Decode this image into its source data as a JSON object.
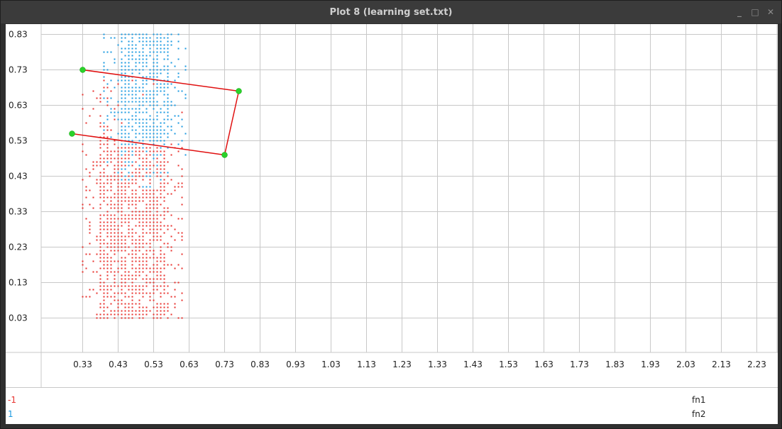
{
  "window": {
    "title": "Plot 8 (learning set.txt)",
    "buttons": {
      "minimize": "_",
      "maximize": "□",
      "close": "✕"
    }
  },
  "colors": {
    "class_neg": "#e8322e",
    "class_pos": "#1b9ae0",
    "polyline": "#e01010",
    "vertex": "#2bd12b",
    "grid": "#c8c8c8"
  },
  "legend": [
    {
      "label": "-1",
      "color": "#e8322e"
    },
    {
      "label": "1",
      "color": "#1b9ae0"
    }
  ],
  "footer": {
    "x_feature": "fn1",
    "y_feature": "fn2"
  },
  "chart_data": {
    "type": "scatter",
    "xlabel": "",
    "ylabel": "",
    "xlim": [
      0.23,
      2.28
    ],
    "ylim": [
      -0.07,
      0.86
    ],
    "x_ticks": [
      "0.33",
      "0.43",
      "0.53",
      "0.63",
      "0.73",
      "0.83",
      "0.93",
      "1.03",
      "1.13",
      "1.23",
      "1.33",
      "1.43",
      "1.53",
      "1.63",
      "1.73",
      "1.83",
      "1.93",
      "2.03",
      "2.13",
      "2.23"
    ],
    "y_ticks": [
      "0.03",
      "0.13",
      "0.23",
      "0.33",
      "0.43",
      "0.53",
      "0.63",
      "0.73",
      "0.83"
    ],
    "grid": true,
    "series": [
      {
        "name": "-1",
        "cloud": {
          "x_range": [
            0.33,
            0.61
          ],
          "y_range": [
            0.03,
            0.7
          ],
          "spacing": 0.01
        }
      },
      {
        "name": "1",
        "cloud": {
          "x_range": [
            0.39,
            0.62
          ],
          "y_range": [
            0.4,
            0.83
          ],
          "spacing": 0.01
        }
      }
    ],
    "polyline": [
      [
        0.33,
        0.73
      ],
      [
        0.77,
        0.67
      ],
      [
        0.73,
        0.49
      ],
      [
        0.3,
        0.55
      ]
    ]
  }
}
